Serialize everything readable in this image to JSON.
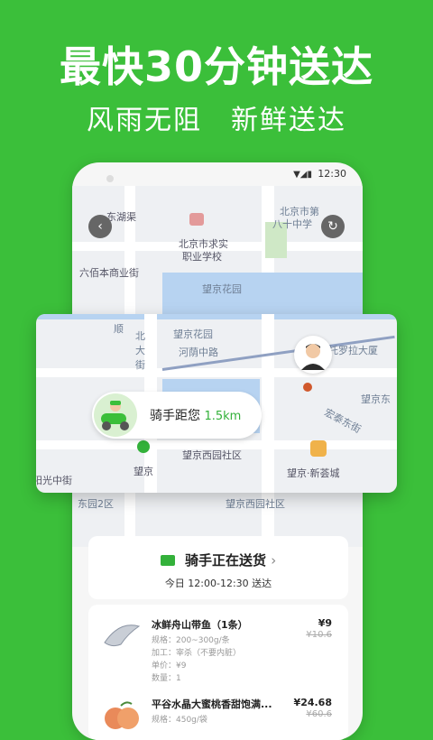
{
  "headline": {
    "title": "最快30分钟送达",
    "subtitle": "风雨无阻　新鲜送达"
  },
  "status_bar": {
    "time": "12:30"
  },
  "map_labels": {
    "l1": "东湖渠",
    "l2": "北京市第",
    "l3": "八十中学",
    "l4": "北京市求实",
    "l5": "职业学校",
    "l6": "六佰本商业街",
    "l7": "望京花园",
    "l8": "东园2区",
    "l9": "望京西园社区",
    "l10": "望京"
  },
  "card_labels": {
    "c1": "望京花园",
    "c2": "河荫中路",
    "c3": "北",
    "c4": "大",
    "c5": "街",
    "c6": "托罗拉大厦",
    "c7": "望京东",
    "c8": "宏泰东街",
    "c9": "望京西园社区",
    "c10": "望京·新荟城",
    "c11": "阳光中街",
    "c12": "望京",
    "c13": "街",
    "c14": "顺"
  },
  "rider": {
    "label": "骑手距您",
    "distance": "1.5km"
  },
  "delivery": {
    "status": "骑手正在送货",
    "time_label": "今日 12:00-12:30 送达"
  },
  "order_items": [
    {
      "name": "冰鲜舟山带鱼（1条）",
      "price": "¥9",
      "old_price": "¥10.6",
      "spec": "规格：200~300g/条",
      "process": "加工：宰杀（不要内脏）",
      "unit_price": "单价：¥9",
      "quantity": "数量：1"
    },
    {
      "name": "平谷水晶大蜜桃香甜饱满...",
      "price": "¥24.68",
      "old_price": "¥60.6",
      "spec": "规格：450g/袋"
    }
  ],
  "colors": {
    "brand_green": "#3bbf3a",
    "accent_green": "#33b13a"
  }
}
